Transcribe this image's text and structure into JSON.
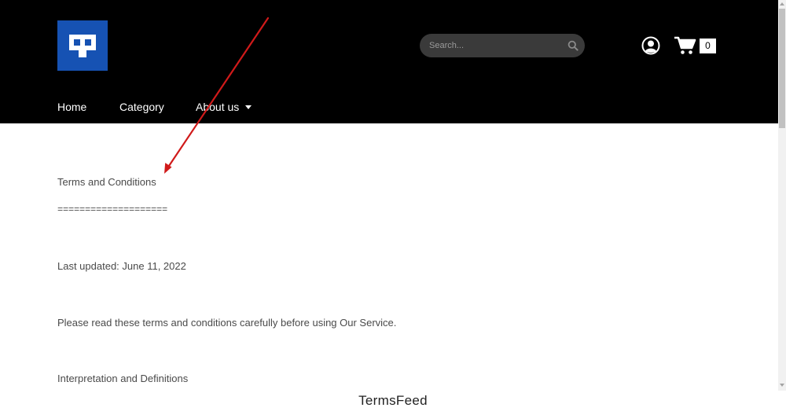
{
  "header": {
    "logo": {
      "icon": "brand-logo-icon",
      "color": "#1652b3"
    },
    "search": {
      "placeholder": "Search...",
      "value": "",
      "icon": "search-icon"
    },
    "account": {
      "icon": "account-icon"
    },
    "cart": {
      "icon": "cart-icon",
      "count": "0"
    }
  },
  "nav": {
    "items": [
      {
        "label": "Home"
      },
      {
        "label": "Category"
      },
      {
        "label": "About us",
        "icon": "caret-down-icon"
      }
    ]
  },
  "content": {
    "lines": [
      "Terms and Conditions",
      "====================",
      "Last updated: June 11, 2022",
      "Please read these terms and conditions carefully before using Our Service.",
      "Interpretation and Definitions"
    ]
  },
  "banner": {
    "text": "TermsFeed"
  },
  "annotation": {
    "type": "arrow",
    "color": "#d01a1a"
  }
}
